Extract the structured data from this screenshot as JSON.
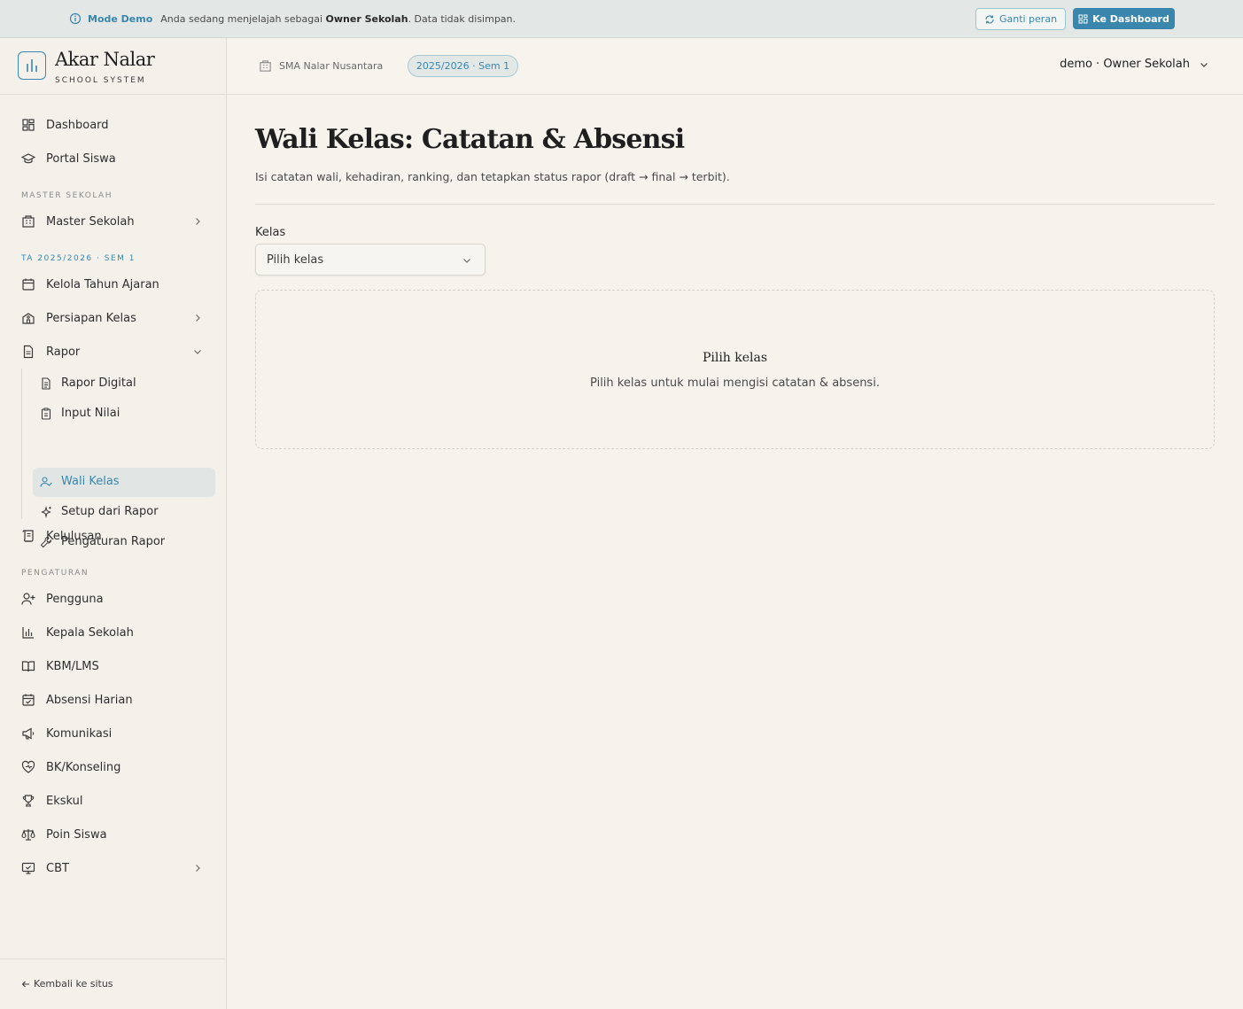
{
  "banner": {
    "mode": "Mode Demo",
    "text_before": "Anda sedang menjelajah sebagai ",
    "role": "Owner Sekolah",
    "text_after": ". Data tidak disimpan.",
    "switch_role": "Ganti peran",
    "to_dashboard": "Ke Dashboard"
  },
  "brand": {
    "name": "Akar Nalar",
    "sub": "SCHOOL SYSTEM"
  },
  "sidebar": {
    "items": [
      {
        "label": "Dashboard"
      },
      {
        "label": "Portal Siswa"
      },
      {
        "label": "Master Sekolah"
      },
      {
        "label": "Kelola Tahun Ajaran"
      },
      {
        "label": "Persiapan Kelas"
      },
      {
        "label": "Rapor"
      },
      {
        "label": "Kelulusan"
      },
      {
        "label": "Pengguna"
      },
      {
        "label": "Kepala Sekolah"
      },
      {
        "label": "KBM/LMS"
      },
      {
        "label": "Absensi Harian"
      },
      {
        "label": "Komunikasi"
      },
      {
        "label": "BK/Konseling"
      },
      {
        "label": "Ekskul"
      },
      {
        "label": "Poin Siswa"
      },
      {
        "label": "CBT"
      }
    ],
    "sub_items": [
      {
        "label": "Rapor Digital"
      },
      {
        "label": "Input Nilai"
      },
      {
        "label": "Wali Kelas"
      },
      {
        "label": "Setup dari Rapor"
      },
      {
        "label": "Pengaturan Rapor"
      }
    ],
    "sections": {
      "master": "MASTER SEKOLAH",
      "term": "TA 2025/2026 · SEM 1",
      "settings": "PENGATURAN"
    },
    "back": "Kembali ke situs"
  },
  "header": {
    "school": "SMA Nalar Nusantara",
    "term": "2025/2026 · Sem 1",
    "user": "demo · Owner Sekolah"
  },
  "main": {
    "title": "Wali Kelas: Catatan & Absensi",
    "description": "Isi catatan wali, kehadiran, ranking, dan tetapkan status rapor (draft → final → terbit).",
    "class_label": "Kelas",
    "class_select_value": "Pilih kelas",
    "empty_title": "Pilih kelas",
    "empty_desc": "Pilih kelas untuk mulai mengisi catatan & absensi."
  },
  "colors": {
    "accent": "#3a86ad",
    "background": "#f6f3ed",
    "active_bg": "#e1e6e4"
  }
}
